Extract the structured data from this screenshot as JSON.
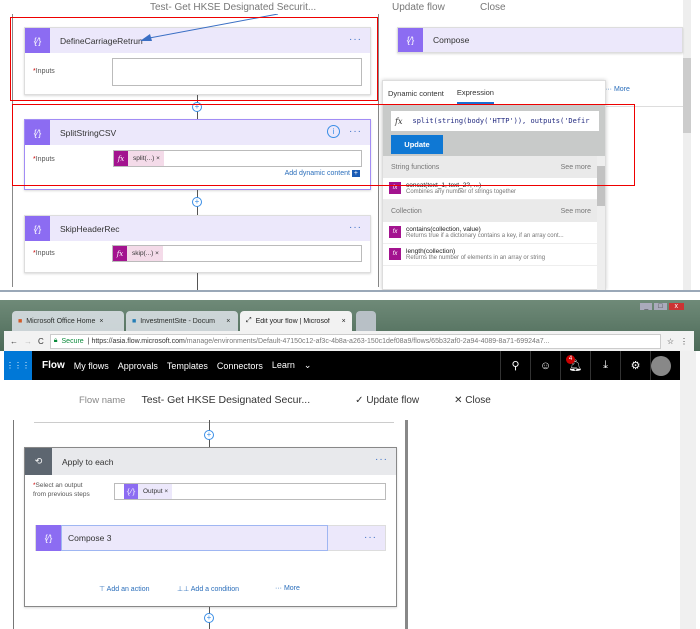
{
  "top_panel": {
    "header_partial": {
      "flow_name_title": "Test- Get HKSE Designated Securit...",
      "update_flow": "Update flow",
      "close": "Close"
    },
    "cards": [
      {
        "title": "DefineCarriageRetrun",
        "input_label": "Inputs",
        "input_value": ""
      },
      {
        "title": "SplitStringCSV",
        "input_label": "Inputs",
        "token": "split(...)",
        "add_dynamic": "Add dynamic content"
      },
      {
        "title": "SkipHeaderRec",
        "input_label": "Inputs",
        "token": "skip(...)"
      }
    ],
    "compose_card": {
      "title": "Compose"
    },
    "more_link": "More",
    "popup": {
      "tabs": [
        "Dynamic content",
        "Expression"
      ],
      "active_tab": "Expression",
      "expression": "split(string(body('HTTP')), outputs('Defir",
      "update_button": "Update",
      "sections": [
        {
          "title": "String functions",
          "see_more": "See more",
          "functions": [
            {
              "name": "concat(text_1, text_2?, ...)",
              "desc": "Combines any number of strings together"
            }
          ]
        },
        {
          "title": "Collection",
          "see_more": "See more",
          "functions": [
            {
              "name": "contains(collection, value)",
              "desc": "Returns true if a dictionary contains a key, if an array cont..."
            },
            {
              "name": "length(collection)",
              "desc": "Returns the number of elements in an array or string"
            }
          ]
        }
      ]
    }
  },
  "browser": {
    "tabs": [
      {
        "label": "Microsoft Office Home"
      },
      {
        "label": "InvestmentSite - Docum"
      },
      {
        "label": "Edit your flow | Microsof",
        "active": true
      }
    ],
    "secure": "Secure",
    "url_host": "https://asia.flow.microsoft.com",
    "url_path": "/manage/environments/Default-47150c12-af3c-4b8a-a263-150c1def08a9/flows/65b32af0-2a94-4089-8a71-69924a7..."
  },
  "nav": {
    "brand": "Flow",
    "items": [
      "My flows",
      "Approvals",
      "Templates",
      "Connectors",
      "Learn"
    ],
    "notification_count": "4"
  },
  "flow_header": {
    "label": "Flow name",
    "title": "Test- Get HKSE Designated Secur...",
    "update": "Update flow",
    "close": "Close"
  },
  "apply_each": {
    "title": "Apply to each",
    "select_label_1": "Select an output",
    "select_label_2": "from previous steps",
    "token": "Output",
    "inner_card": "Compose 3",
    "add_action": "Add an action",
    "add_condition": "Add a condition",
    "more": "More"
  },
  "colors": {
    "accent": "#8c6cf2",
    "fx": "#a3138f",
    "blue": "#0078d7",
    "highlight": "#e00000"
  }
}
